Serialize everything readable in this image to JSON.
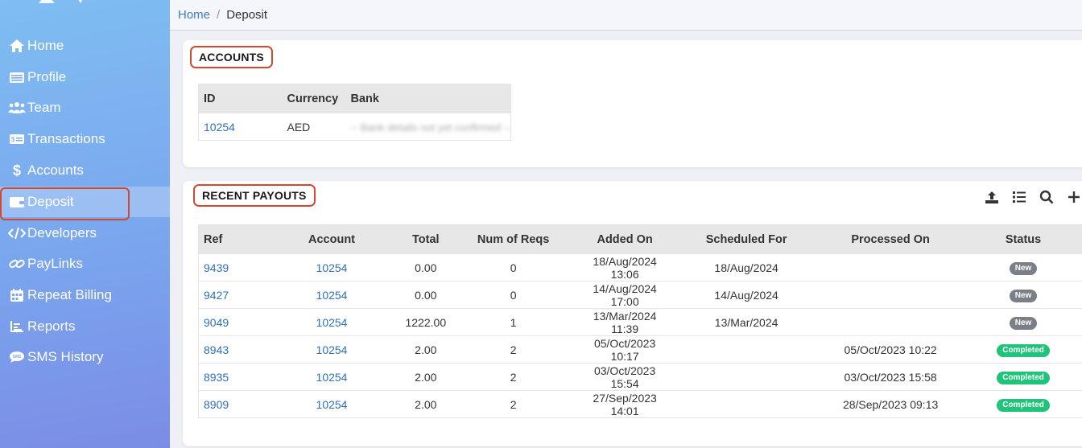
{
  "sidebar": {
    "items": [
      {
        "label": "Home",
        "icon": "home-icon"
      },
      {
        "label": "Profile",
        "icon": "profile-card-icon"
      },
      {
        "label": "Team",
        "icon": "team-icon"
      },
      {
        "label": "Transactions",
        "icon": "transactions-icon"
      },
      {
        "label": "Accounts",
        "icon": "dollar-icon"
      },
      {
        "label": "Deposit",
        "icon": "wallet-icon"
      },
      {
        "label": "Developers",
        "icon": "code-icon"
      },
      {
        "label": "PayLinks",
        "icon": "link-icon"
      },
      {
        "label": "Repeat Billing",
        "icon": "calendar-icon"
      },
      {
        "label": "Reports",
        "icon": "chart-icon"
      },
      {
        "label": "SMS History",
        "icon": "sms-icon"
      }
    ],
    "active": "Deposit"
  },
  "breadcrumb": {
    "home": "Home",
    "separator": "/",
    "current": "Deposit"
  },
  "accounts": {
    "title": "ACCOUNTS",
    "columns": [
      "ID",
      "Currency",
      "Bank"
    ],
    "rows": [
      {
        "id": "10254",
        "currency": "AED",
        "bank": "-- Bank details not yet confirmed --"
      }
    ]
  },
  "payouts": {
    "title": "RECENT PAYOUTS",
    "toolbar": [
      "upload-icon",
      "list-icon",
      "search-icon",
      "plus-icon"
    ],
    "columns": [
      "Ref",
      "Account",
      "Total",
      "Num of Reqs",
      "Added On",
      "Scheduled For",
      "Processed On",
      "Status"
    ],
    "rows": [
      {
        "ref": "9439",
        "account": "10254",
        "total": "0.00",
        "reqs": "0",
        "added": "18/Aug/2024 13:06",
        "scheduled": "18/Aug/2024",
        "processed": "",
        "status": "New"
      },
      {
        "ref": "9427",
        "account": "10254",
        "total": "0.00",
        "reqs": "0",
        "added": "14/Aug/2024 17:00",
        "scheduled": "14/Aug/2024",
        "processed": "",
        "status": "New"
      },
      {
        "ref": "9049",
        "account": "10254",
        "total": "1222.00",
        "reqs": "1",
        "added": "13/Mar/2024 11:39",
        "scheduled": "13/Mar/2024",
        "processed": "",
        "status": "New"
      },
      {
        "ref": "8943",
        "account": "10254",
        "total": "2.00",
        "reqs": "2",
        "added": "05/Oct/2023 10:17",
        "scheduled": "",
        "processed": "05/Oct/2023 10:22",
        "status": "Completed"
      },
      {
        "ref": "8935",
        "account": "10254",
        "total": "2.00",
        "reqs": "2",
        "added": "03/Oct/2023 15:54",
        "scheduled": "",
        "processed": "03/Oct/2023 15:58",
        "status": "Completed"
      },
      {
        "ref": "8909",
        "account": "10254",
        "total": "2.00",
        "reqs": "2",
        "added": "27/Sep/2023 14:01",
        "scheduled": "",
        "processed": "28/Sep/2023 09:13",
        "status": "Completed"
      }
    ]
  },
  "colors": {
    "accent": "#2f6fb8",
    "highlight": "#d4482f",
    "new": "#7b7f86",
    "completed": "#1fc47a"
  }
}
